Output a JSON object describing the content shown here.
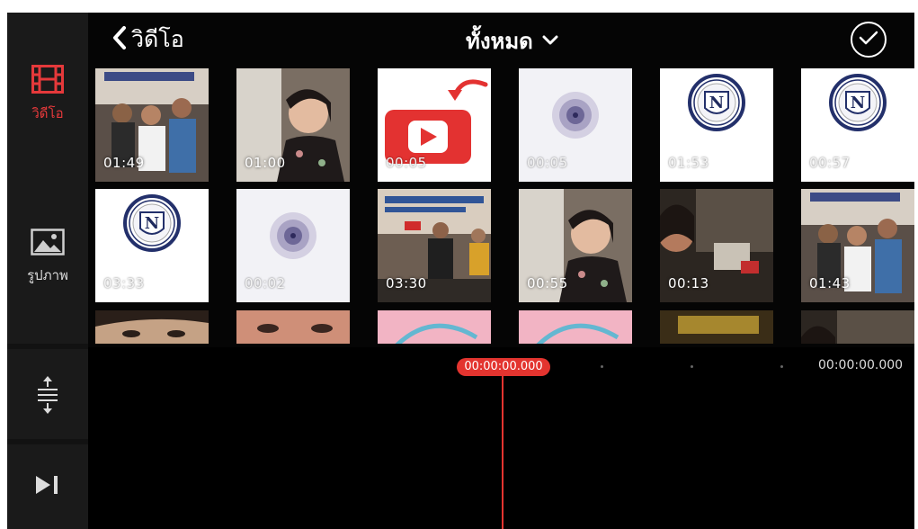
{
  "header": {
    "back_label": "วิดีโอ",
    "title": "ทั้งหมด",
    "icons": {
      "back": "chevron-left-icon",
      "title": "chevron-down-icon",
      "confirm": "check-circle-icon"
    }
  },
  "sidebar": {
    "tabs": [
      {
        "label": "วิดีโอ",
        "icon": "film-icon",
        "active": true
      },
      {
        "label": "รูปภาพ",
        "icon": "image-icon",
        "active": false
      }
    ],
    "tools": [
      {
        "icon": "expand-vertical-icon"
      },
      {
        "icon": "skip-forward-icon"
      }
    ]
  },
  "grid": {
    "rows": [
      [
        {
          "duration": "01:49",
          "kind": "photo-group"
        },
        {
          "duration": "01:00",
          "kind": "photo-woman"
        },
        {
          "duration": "00:05",
          "kind": "youtube"
        },
        {
          "duration": "00:05",
          "kind": "blur-logo"
        },
        {
          "duration": "01:53",
          "kind": "school-logo"
        },
        {
          "duration": "00:57",
          "kind": "school-logo"
        }
      ],
      [
        {
          "duration": "03:33",
          "kind": "school-logo"
        },
        {
          "duration": "00:02",
          "kind": "blur-logo"
        },
        {
          "duration": "03:30",
          "kind": "photo-stage"
        },
        {
          "duration": "00:55",
          "kind": "photo-woman"
        },
        {
          "duration": "00:13",
          "kind": "photo-dark"
        },
        {
          "duration": "01:43",
          "kind": "photo-group"
        }
      ],
      [
        {
          "duration": "",
          "kind": "photo-kid"
        },
        {
          "duration": "",
          "kind": "photo-face"
        },
        {
          "duration": "",
          "kind": "photo-pink"
        },
        {
          "duration": "",
          "kind": "photo-pink"
        },
        {
          "duration": "",
          "kind": "photo-yellow"
        },
        {
          "duration": "",
          "kind": "photo-dark"
        }
      ]
    ],
    "logo_letter": "N"
  },
  "timeline": {
    "current_time": "00:00:00.000",
    "total_time": "00:00:00.000"
  },
  "colors": {
    "accent": "#e3342f",
    "background": "#050505",
    "rail": "#121212"
  }
}
